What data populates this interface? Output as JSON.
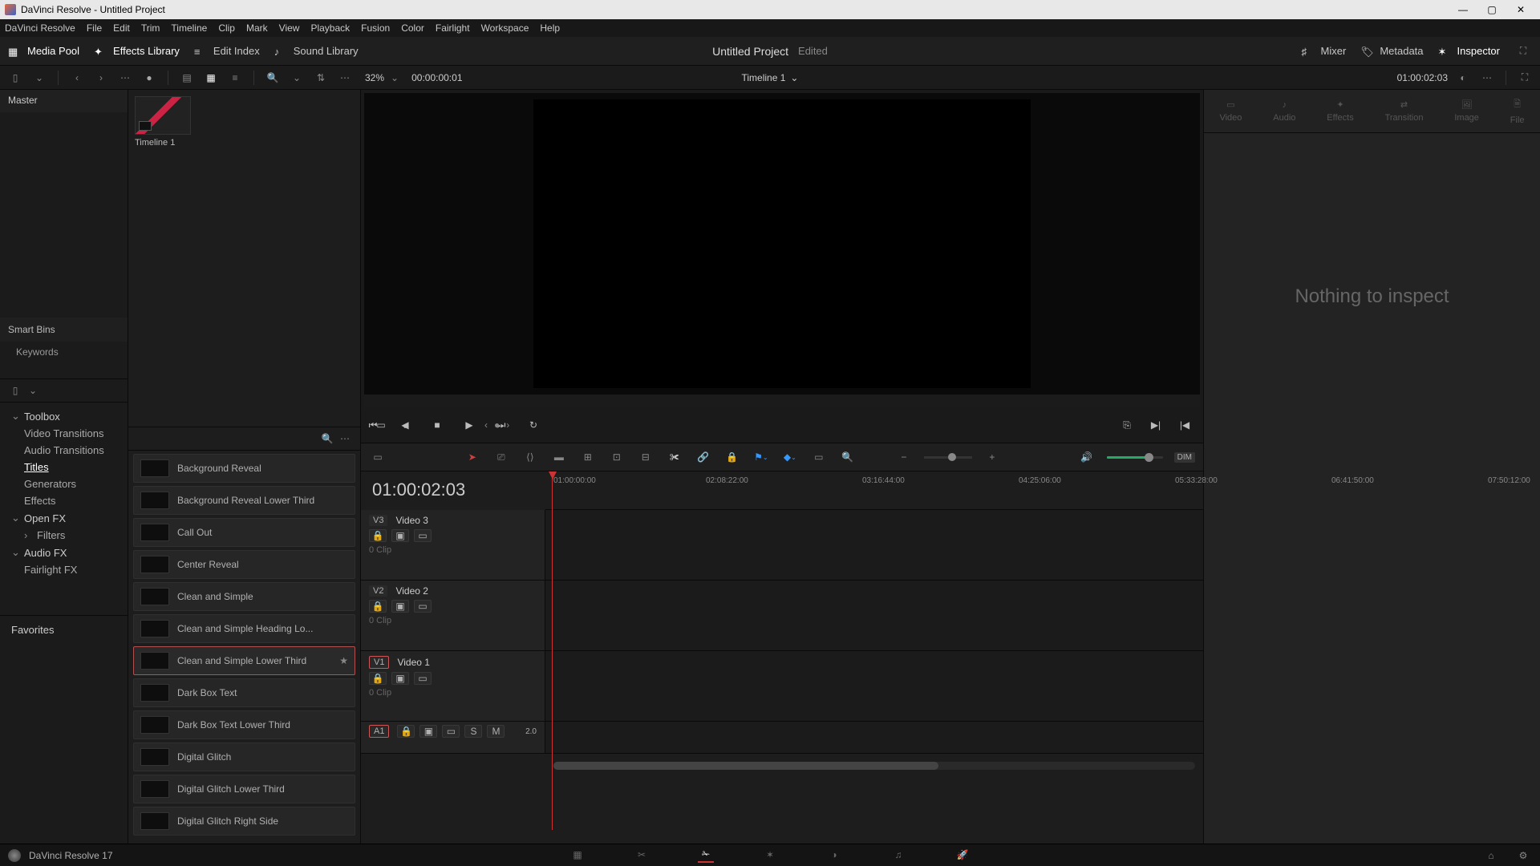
{
  "titlebar": {
    "label": "DaVinci Resolve - Untitled Project"
  },
  "menu": [
    "DaVinci Resolve",
    "File",
    "Edit",
    "Trim",
    "Timeline",
    "Clip",
    "Mark",
    "View",
    "Playback",
    "Fusion",
    "Color",
    "Fairlight",
    "Workspace",
    "Help"
  ],
  "toolbar": {
    "media_pool": "Media Pool",
    "effects_library": "Effects Library",
    "edit_index": "Edit Index",
    "sound_library": "Sound Library",
    "mixer": "Mixer",
    "metadata": "Metadata",
    "inspector": "Inspector"
  },
  "project": {
    "name": "Untitled Project",
    "status": "Edited"
  },
  "subbar": {
    "zoom": "32%",
    "tc_left": "00:00:00:01",
    "timeline_name": "Timeline 1",
    "tc_right": "01:00:02:03"
  },
  "mediapool": {
    "master": "Master",
    "thumb_label": "Timeline 1",
    "smartbins": "Smart Bins",
    "keywords": "Keywords"
  },
  "toolbox": {
    "root": "Toolbox",
    "items": [
      "Video Transitions",
      "Audio Transitions",
      "Titles",
      "Generators",
      "Effects"
    ],
    "openfx": "Open FX",
    "filters": "Filters",
    "audiofx": "Audio FX",
    "fairlightfx": "Fairlight FX",
    "favorites": "Favorites",
    "selected": "Titles"
  },
  "titles": [
    {
      "name": "Background Reveal"
    },
    {
      "name": "Background Reveal Lower Third"
    },
    {
      "name": "Call Out"
    },
    {
      "name": "Center Reveal"
    },
    {
      "name": "Clean and Simple"
    },
    {
      "name": "Clean and Simple Heading Lo..."
    },
    {
      "name": "Clean and Simple Lower Third",
      "selected": true
    },
    {
      "name": "Dark Box Text"
    },
    {
      "name": "Dark Box Text Lower Third"
    },
    {
      "name": "Digital Glitch"
    },
    {
      "name": "Digital Glitch Lower Third"
    },
    {
      "name": "Digital Glitch Right Side"
    }
  ],
  "timeline": {
    "big_tc": "01:00:02:03",
    "ruler": [
      "01:00:00:00",
      "02:08:22:00",
      "03:16:44:00",
      "04:25:06:00",
      "05:33:28:00",
      "06:41:50:00",
      "07:50:12:00"
    ],
    "tracks": [
      {
        "id": "V3",
        "name": "Video 3",
        "clip": "0 Clip"
      },
      {
        "id": "V2",
        "name": "Video 2",
        "clip": "0 Clip"
      },
      {
        "id": "V1",
        "name": "Video 1",
        "clip": "0 Clip",
        "selected": true
      }
    ],
    "audio": {
      "id": "A1",
      "s": "S",
      "m": "M",
      "val": "2.0"
    }
  },
  "inspector": {
    "tabs": [
      "Video",
      "Audio",
      "Effects",
      "Transition",
      "Image",
      "File"
    ],
    "empty": "Nothing to inspect"
  },
  "footer": {
    "version": "DaVinci Resolve 17"
  }
}
